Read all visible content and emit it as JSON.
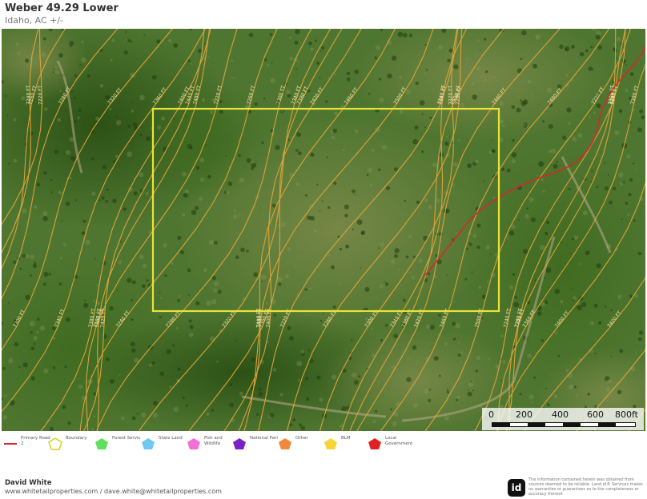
{
  "header": {
    "title": "Weber 49.29 Lower",
    "subtitle": "Idaho,  AC +/-"
  },
  "map": {
    "imagery": "satellite",
    "boundary_color": "#e8e33a",
    "road_color": "#d8262b",
    "contour_color": "#e0a53a",
    "contour_labels": [
      "7220 FT",
      "7240 FT",
      "7260 FT",
      "7280 FT",
      "7300 FT",
      "7320 FT",
      "7340 FT",
      "7360 FT",
      "7380 FT",
      "7400 FT",
      "7420 FT",
      "7440 FT",
      "7460 FT",
      "7480 FT",
      "7500 FT"
    ]
  },
  "scalebar": {
    "labels": [
      "0",
      "200",
      "400",
      "600",
      "800ft"
    ]
  },
  "legend": {
    "items": [
      {
        "label": "Primary Road 2",
        "symbol": "line",
        "color": "#d8262b"
      },
      {
        "label": "Boundary",
        "symbol": "outline",
        "color": "#d6cf2a"
      },
      {
        "label": "Forest Servic",
        "symbol": "fill",
        "color": "#5ee05a"
      },
      {
        "label": "State Land",
        "symbol": "fill",
        "color": "#6ec8f2"
      },
      {
        "label": "Fish and Wildlife",
        "symbol": "fill",
        "color": "#f36fd8"
      },
      {
        "label": "National Parl",
        "symbol": "fill",
        "color": "#7a22c8"
      },
      {
        "label": "Other",
        "symbol": "fill",
        "color": "#f08a3a"
      },
      {
        "label": "BLM",
        "symbol": "fill",
        "color": "#f7d43a"
      },
      {
        "label": "Local Government",
        "symbol": "fill",
        "color": "#e02222"
      }
    ]
  },
  "footer": {
    "name": "David White",
    "contact": "www.whitetailproperties.com / dave.white@whitetailproperties.com",
    "logo_text": "id",
    "disclaimer": "The information contained herein was obtained from sources deemed to be reliable. Land id® Services makes no warranties or guarantees as to the completeness or accuracy thereof."
  }
}
